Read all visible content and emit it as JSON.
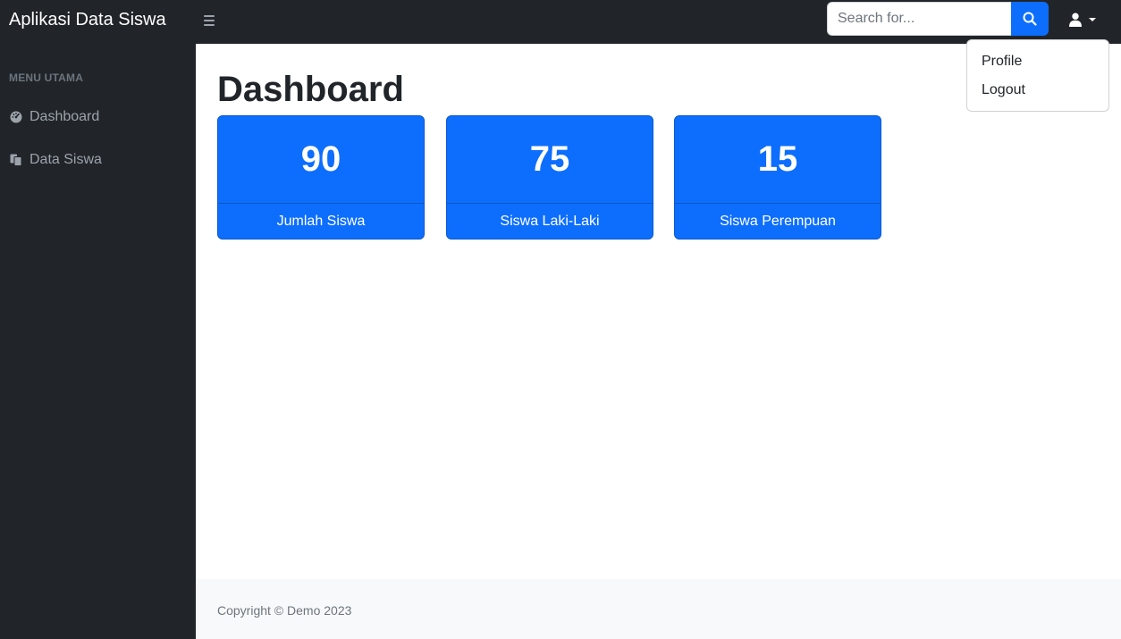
{
  "app": {
    "brand": "Aplikasi Data Siswa"
  },
  "search": {
    "placeholder": "Search for..."
  },
  "user_menu": {
    "items": [
      "Profile",
      "Logout"
    ]
  },
  "sidebar": {
    "heading": "MENU UTAMA",
    "items": [
      {
        "label": "Dashboard",
        "icon": "tachometer-icon"
      },
      {
        "label": "Data Siswa",
        "icon": "copy-icon"
      }
    ]
  },
  "main": {
    "title": "Dashboard",
    "cards": [
      {
        "value": "90",
        "label": "Jumlah Siswa"
      },
      {
        "value": "75",
        "label": "Siswa Laki-Laki"
      },
      {
        "value": "15",
        "label": "Siswa Perempuan"
      }
    ]
  },
  "footer": {
    "text": "Copyright © Demo 2023"
  },
  "colors": {
    "primary": "#0d6efd",
    "dark": "#212529",
    "footer_bg": "#f8f9fa"
  }
}
